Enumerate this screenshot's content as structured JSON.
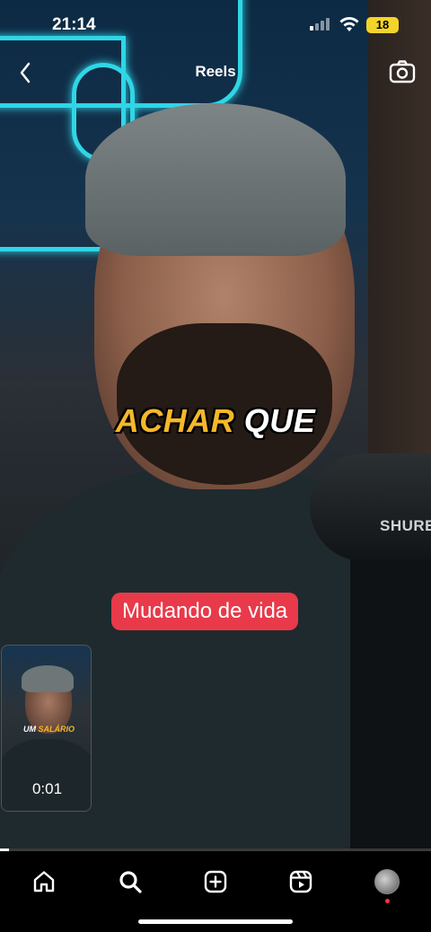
{
  "status_bar": {
    "time": "21:14",
    "battery": "18"
  },
  "header": {
    "title": "Reels"
  },
  "video": {
    "caption_word1": "ACHAR",
    "caption_word2": "QUE",
    "mic_brand": "SHURE",
    "progress": 0.02
  },
  "pill": {
    "label": "Mudando de vida"
  },
  "mini_preview": {
    "label_word1": "UM",
    "label_word2": "SALÁRIO",
    "time": "0:01"
  },
  "tabbar": {
    "items": [
      "home-icon",
      "search-icon",
      "create-icon",
      "reels-icon",
      "profile-avatar"
    ]
  },
  "colors": {
    "accent_caption": "#f5b82a",
    "pill_bg": "#e83a4a",
    "neon": "#2fd6e6"
  }
}
